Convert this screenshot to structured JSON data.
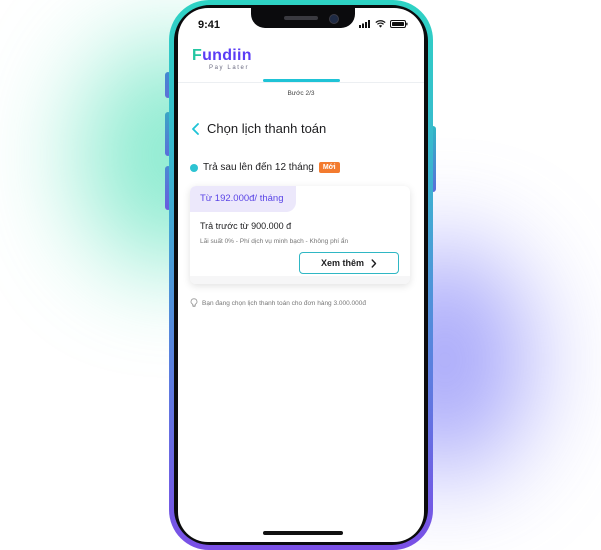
{
  "status_bar": {
    "time": "9:41",
    "icons": [
      "signal-icon",
      "wifi-icon",
      "battery-icon"
    ]
  },
  "brand": {
    "first_letter": "F",
    "name_rest": "undiin",
    "tagline": "Pay Later",
    "colors": {
      "primary": "#5b3df5",
      "accent": "#23c6a2"
    }
  },
  "progress": {
    "step_label": "Bước 2/3",
    "current_step": 2,
    "total_steps": 3,
    "color": "#1fc3d6"
  },
  "header": {
    "back_icon": "chevron-left-icon",
    "title": "Chọn lịch thanh toán"
  },
  "section": {
    "label": "Trả sau lên đến 12 tháng",
    "badge": "Mới",
    "badge_color": "#f37b2f"
  },
  "plan_card": {
    "price": "Từ 192.000đ/ tháng",
    "prepay": "Trả trước từ 900.000 đ",
    "note": "Lãi suất 0% - Phí dịch vụ minh bạch - Không phí ẩn",
    "button_label": "Xem thêm",
    "button_icon": "chevron-right-icon"
  },
  "hint": {
    "icon": "lightbulb-icon",
    "text": "Bạn đang chọn lịch thanh toán cho đơn hàng 3.000.000đ"
  }
}
